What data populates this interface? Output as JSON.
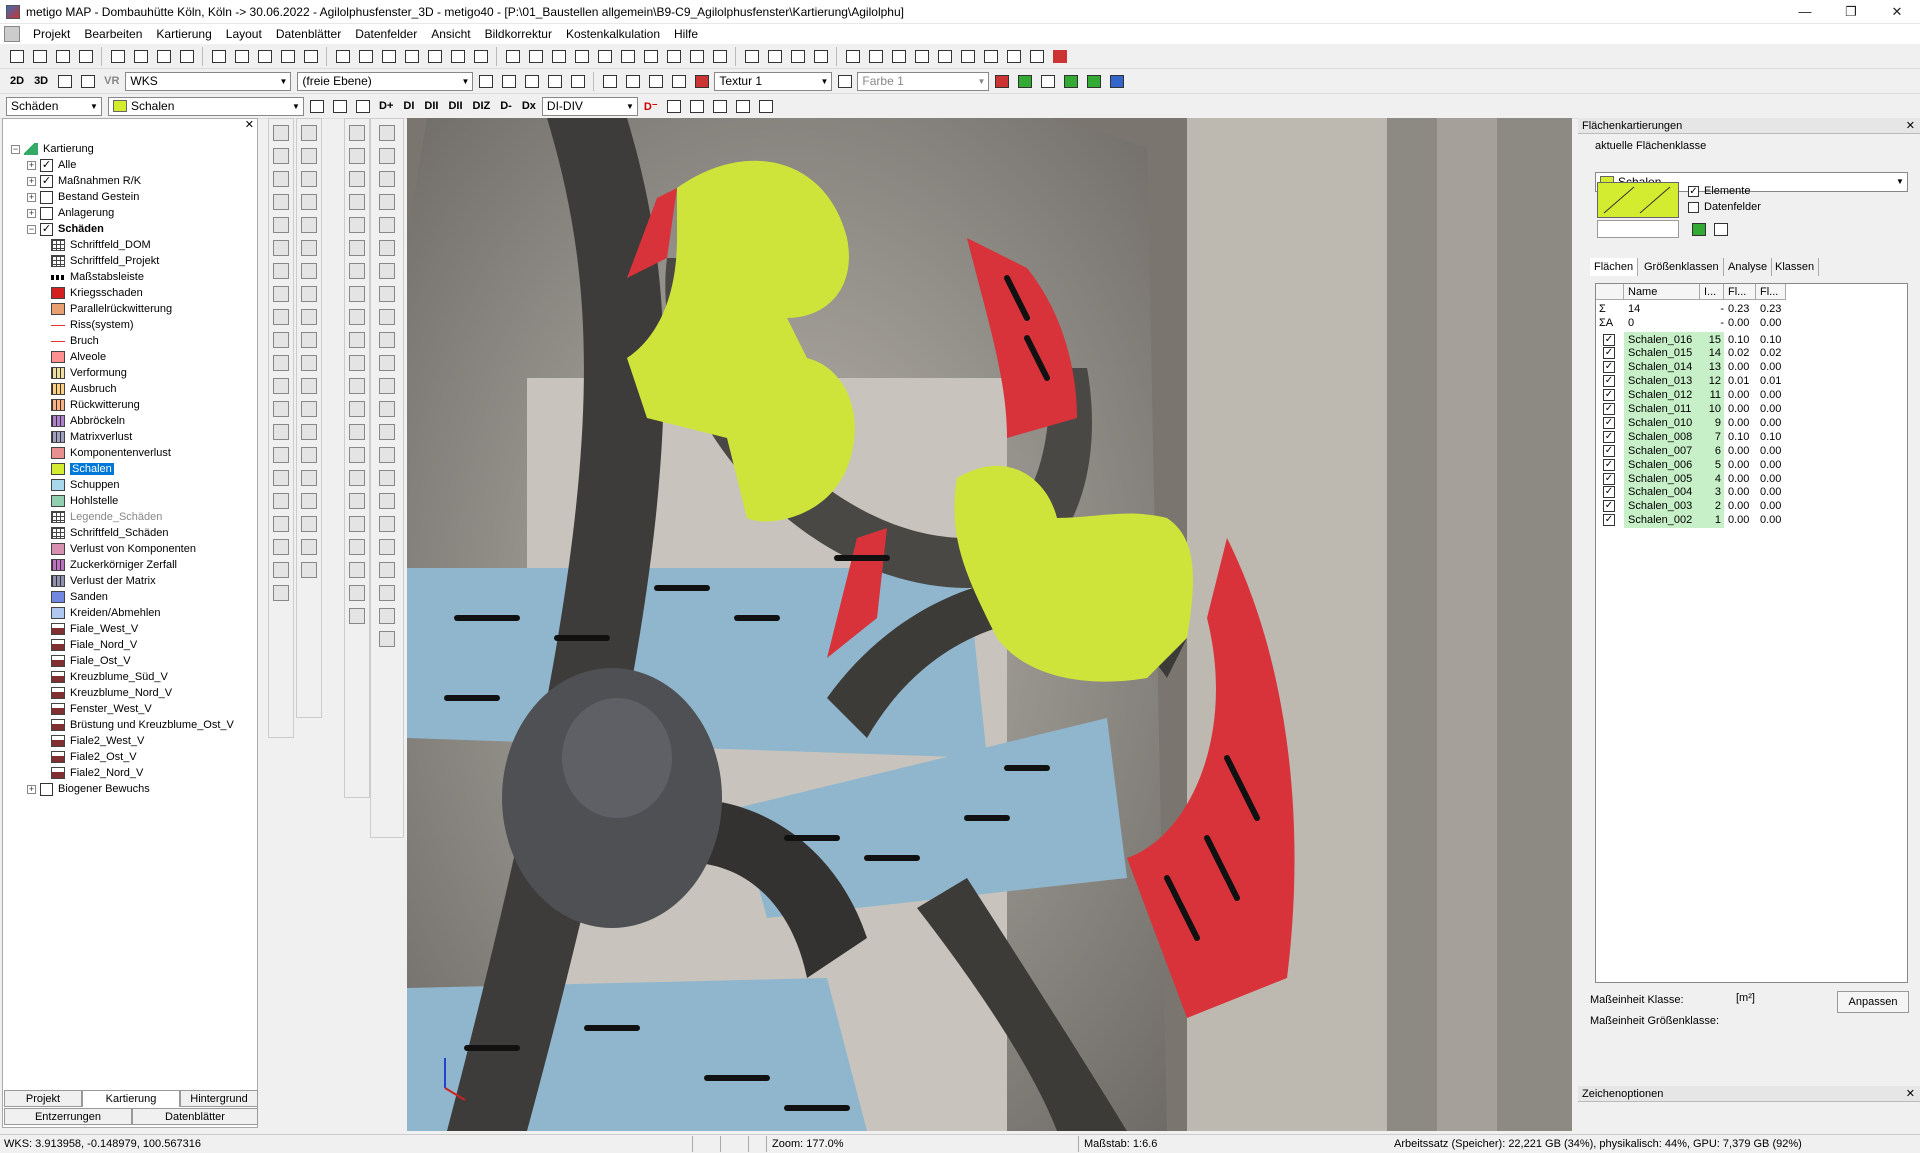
{
  "window": {
    "title": "metigo MAP - Dombauhütte Köln, Köln -> 30.06.2022 - Agilolphusfenster_3D - metigo40 - [P:\\01_Baustellen allgemein\\B9-C9_Agilolphusfenster\\Kartierung\\Agilolphu]",
    "min": "—",
    "max": "❐",
    "close": "✕"
  },
  "menu": [
    "Projekt",
    "Bearbeiten",
    "Kartierung",
    "Layout",
    "Datenblätter",
    "Datenfelder",
    "Ansicht",
    "Bildkorrektur",
    "Kostenkalkulation",
    "Hilfe"
  ],
  "toolbar2": {
    "b2d": "2D",
    "b3d": "3D",
    "vr": "VR",
    "coord_system": "WKS",
    "plane": "(freie Ebene)",
    "texture": "Textur 1",
    "color": "Farbe 1"
  },
  "toolbar3": {
    "layer": "Schäden",
    "class": "Schalen",
    "d_plus": "D+",
    "di": "DI",
    "di2": "DI",
    "dii": "DII",
    "diz": "DIZ",
    "d_minus": "D-",
    "dx": "Dx",
    "div": "DI-DIV",
    "dt": "D⁻"
  },
  "tree": {
    "root": "Kartierung",
    "items": [
      {
        "label": "Alle",
        "level": 1,
        "exp": "+",
        "chk": "✓",
        "icon": "",
        "color": ""
      },
      {
        "label": "Maßnahmen R/K",
        "level": 1,
        "exp": "+",
        "chk": "✓",
        "icon": "",
        "color": ""
      },
      {
        "label": "Bestand Gestein",
        "level": 1,
        "exp": "+",
        "chk": "",
        "icon": "",
        "color": ""
      },
      {
        "label": "Anlagerung",
        "level": 1,
        "exp": "+",
        "chk": "",
        "icon": "",
        "color": ""
      },
      {
        "label": "Schäden",
        "level": 1,
        "exp": "−",
        "chk": "✓",
        "icon": "",
        "color": "",
        "bold": true
      },
      {
        "label": "Schriftfeld_DOM",
        "level": 2,
        "icon": "grid",
        "color": "#ffffff"
      },
      {
        "label": "Schriftfeld_Projekt",
        "level": 2,
        "icon": "grid",
        "color": "#ffffff"
      },
      {
        "label": "Maßstabsleiste",
        "level": 2,
        "icon": "dash",
        "color": "#ffffff"
      },
      {
        "label": "Kriegsschaden",
        "level": 2,
        "icon": "fill",
        "color": "#d42020"
      },
      {
        "label": "Parallelrückwitterung",
        "level": 2,
        "icon": "fill",
        "color": "#e8a070"
      },
      {
        "label": "Riss(system)",
        "level": 2,
        "icon": "line",
        "color": "#ffffff"
      },
      {
        "label": "Bruch",
        "level": 2,
        "icon": "line",
        "color": "#ffffff"
      },
      {
        "label": "Alveole",
        "level": 2,
        "icon": "fill",
        "color": "#ff9090"
      },
      {
        "label": "Verformung",
        "level": 2,
        "icon": "hatch",
        "color": "#f0e0a0"
      },
      {
        "label": "Ausbruch",
        "level": 2,
        "icon": "hatch",
        "color": "#ffd080"
      },
      {
        "label": "Rückwitterung",
        "level": 2,
        "icon": "hatch",
        "color": "#ffb080"
      },
      {
        "label": "Abbröckeln",
        "level": 2,
        "icon": "hatch",
        "color": "#b080d0"
      },
      {
        "label": "Matrixverlust",
        "level": 2,
        "icon": "hatch",
        "color": "#a0a0c0"
      },
      {
        "label": "Komponentenverlust",
        "level": 2,
        "icon": "fill",
        "color": "#e89090"
      },
      {
        "label": "Schalen",
        "level": 2,
        "icon": "fill",
        "color": "#d4ec30",
        "selected": true
      },
      {
        "label": "Schuppen",
        "level": 2,
        "icon": "fill",
        "color": "#a8d8ec"
      },
      {
        "label": "Hohlstelle",
        "level": 2,
        "icon": "fill",
        "color": "#90d0b0"
      },
      {
        "label": "Legende_Schäden",
        "level": 2,
        "icon": "grid",
        "color": "#ffffff",
        "grey": true
      },
      {
        "label": "Schriftfeld_Schäden",
        "level": 2,
        "icon": "grid",
        "color": "#ffffff"
      },
      {
        "label": "Verlust von Komponenten",
        "level": 2,
        "icon": "fill",
        "color": "#d890b0"
      },
      {
        "label": "Zuckerkörniger Zerfall",
        "level": 2,
        "icon": "hatch",
        "color": "#c070c0"
      },
      {
        "label": "Verlust der Matrix",
        "level": 2,
        "icon": "hatch",
        "color": "#9090b0"
      },
      {
        "label": "Sanden",
        "level": 2,
        "icon": "fill",
        "color": "#7088e0"
      },
      {
        "label": "Kreiden/Abmehlen",
        "level": 2,
        "icon": "fill",
        "color": "#b0c8f0"
      },
      {
        "label": "Fiale_West_V",
        "level": 2,
        "icon": "bldg",
        "color": "#803030"
      },
      {
        "label": "Fiale_Nord_V",
        "level": 2,
        "icon": "bldg",
        "color": "#803030"
      },
      {
        "label": "Fiale_Ost_V",
        "level": 2,
        "icon": "bldg",
        "color": "#803030"
      },
      {
        "label": "Kreuzblume_Süd_V",
        "level": 2,
        "icon": "bldg",
        "color": "#803030"
      },
      {
        "label": "Kreuzblume_Nord_V",
        "level": 2,
        "icon": "bldg",
        "color": "#803030"
      },
      {
        "label": "Fenster_West_V",
        "level": 2,
        "icon": "bldg",
        "color": "#803030"
      },
      {
        "label": "Brüstung und Kreuzblume_Ost_V",
        "level": 2,
        "icon": "bldg",
        "color": "#803030"
      },
      {
        "label": "Fiale2_West_V",
        "level": 2,
        "icon": "bldg",
        "color": "#803030"
      },
      {
        "label": "Fiale2_Ost_V",
        "level": 2,
        "icon": "bldg",
        "color": "#803030"
      },
      {
        "label": "Fiale2_Nord_V",
        "level": 2,
        "icon": "bldg",
        "color": "#803030"
      },
      {
        "label": "Biogener Bewuchs",
        "level": 1,
        "exp": "+",
        "chk": "",
        "icon": "",
        "color": ""
      }
    ]
  },
  "left_tabs": {
    "projekt": "Projekt",
    "kartierung": "Kartierung",
    "hintergrund": "Hintergrund",
    "entzerrungen": "Entzerrungen",
    "datenblaetter": "Datenblätter"
  },
  "panel": {
    "title": "Flächenkartierungen",
    "current_class_label": "aktuelle Flächenklasse",
    "current_class": "Schalen",
    "elemente": "Elemente",
    "datenfelder": "Datenfelder",
    "tabs": [
      "Flächen",
      "Größenklassen",
      "Analyse",
      "Klassen"
    ],
    "columns": [
      "Name",
      "I...",
      "Fl...",
      "Fl..."
    ],
    "summary": [
      {
        "sym": "Σ",
        "name": "14",
        "i": "-",
        "f1": "0.23",
        "f2": "0.23"
      },
      {
        "sym": "ΣA",
        "name": "0",
        "i": "-",
        "f1": "0.00",
        "f2": "0.00"
      }
    ],
    "rows": [
      {
        "name": "Schalen_016",
        "i": "15",
        "f1": "0.10",
        "f2": "0.10"
      },
      {
        "name": "Schalen_015",
        "i": "14",
        "f1": "0.02",
        "f2": "0.02"
      },
      {
        "name": "Schalen_014",
        "i": "13",
        "f1": "0.00",
        "f2": "0.00"
      },
      {
        "name": "Schalen_013",
        "i": "12",
        "f1": "0.01",
        "f2": "0.01"
      },
      {
        "name": "Schalen_012",
        "i": "11",
        "f1": "0.00",
        "f2": "0.00"
      },
      {
        "name": "Schalen_011",
        "i": "10",
        "f1": "0.00",
        "f2": "0.00"
      },
      {
        "name": "Schalen_010",
        "i": "9",
        "f1": "0.00",
        "f2": "0.00"
      },
      {
        "name": "Schalen_008",
        "i": "7",
        "f1": "0.10",
        "f2": "0.10"
      },
      {
        "name": "Schalen_007",
        "i": "6",
        "f1": "0.00",
        "f2": "0.00"
      },
      {
        "name": "Schalen_006",
        "i": "5",
        "f1": "0.00",
        "f2": "0.00"
      },
      {
        "name": "Schalen_005",
        "i": "4",
        "f1": "0.00",
        "f2": "0.00"
      },
      {
        "name": "Schalen_004",
        "i": "3",
        "f1": "0.00",
        "f2": "0.00"
      },
      {
        "name": "Schalen_003",
        "i": "2",
        "f1": "0.00",
        "f2": "0.00"
      },
      {
        "name": "Schalen_002",
        "i": "1",
        "f1": "0.00",
        "f2": "0.00"
      }
    ],
    "unit_class_label": "Maßeinheit Klasse:",
    "unit_class": "[m²]",
    "unit_size_label": "Maßeinheit Größenklasse:",
    "adjust": "Anpassen",
    "drawing_options": "Zeichenoptionen"
  },
  "status": {
    "coords": "WKS: 3.913958, -0.148979, 100.567316",
    "zoom": "Zoom: 177.0%",
    "scale": "Maßstab: 1:6.6",
    "memory": "Arbeitssatz (Speicher): 22,221 GB (34%), physikalisch: 44%, GPU: 7,379 GB (92%)"
  },
  "colors": {
    "shell_yellow": "#cfe43a",
    "damage_red": "#d8333a",
    "blue_band": "#8fb6cc",
    "selection": "#0078d7"
  }
}
